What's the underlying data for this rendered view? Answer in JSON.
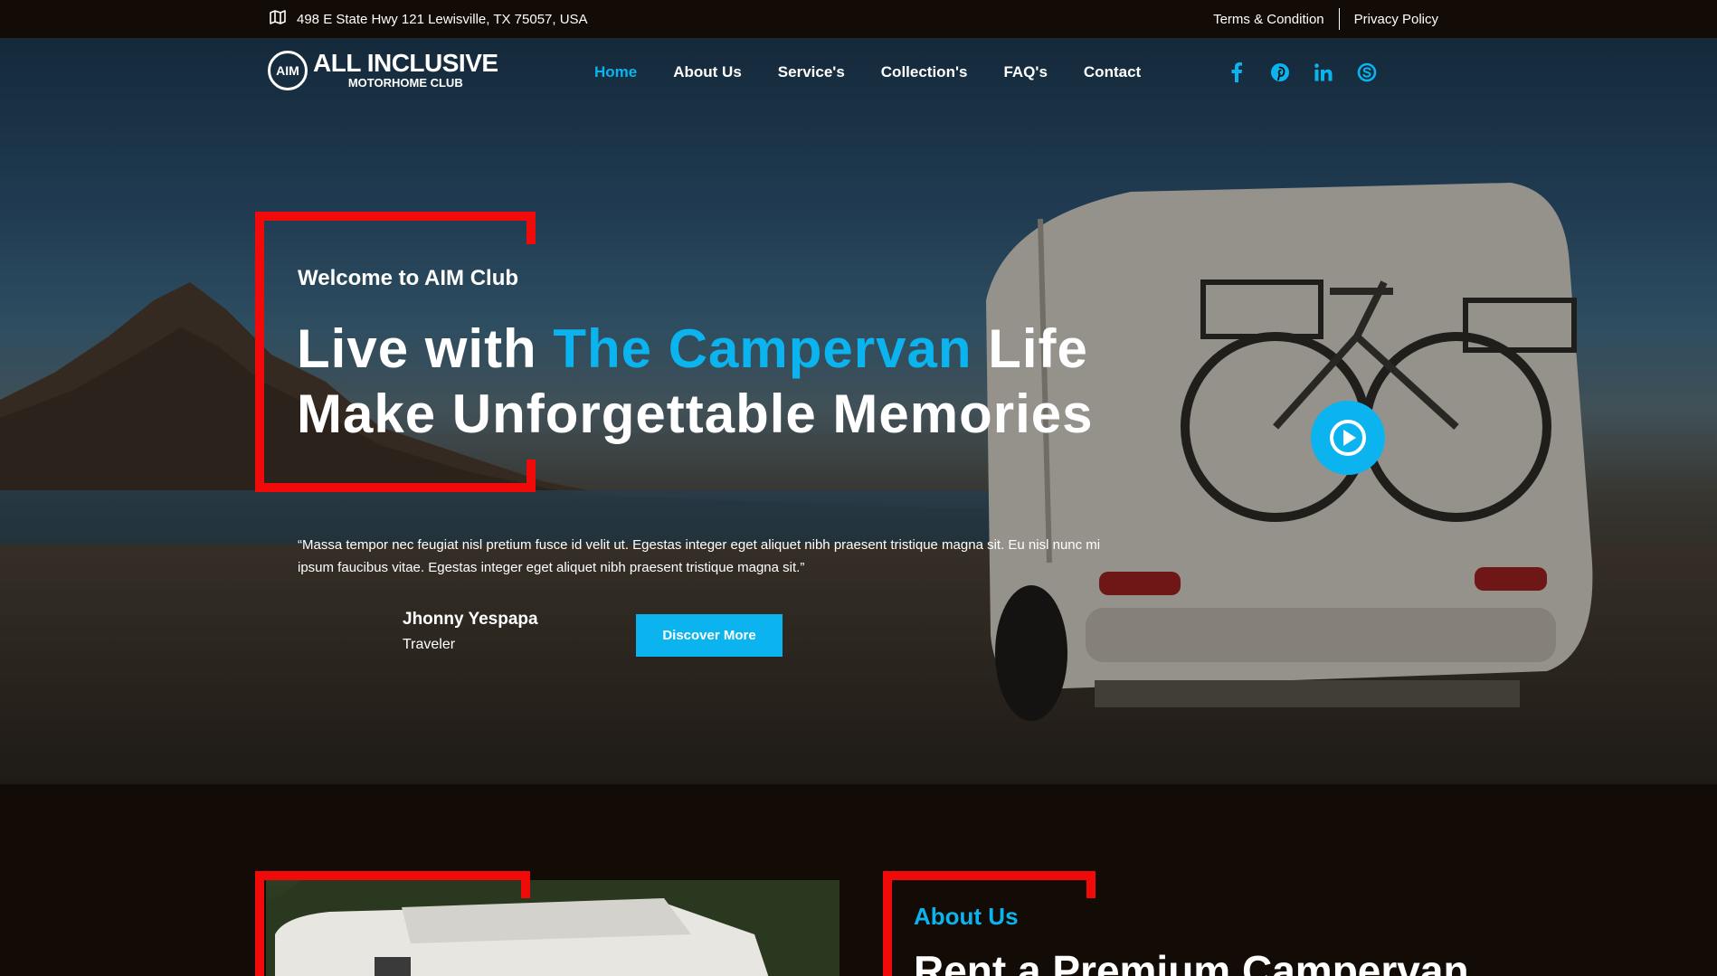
{
  "topbar": {
    "address": "498 E State Hwy 121 Lewisville, TX 75057, USA",
    "address_icon": "map-icon",
    "terms": "Terms & Condition",
    "privacy": "Privacy Policy"
  },
  "logo": {
    "badge": "AIM",
    "line1": "ALL INCLUSIVE",
    "line2": "MOTORHOME CLUB"
  },
  "nav": {
    "items": [
      {
        "label": "Home",
        "active": true
      },
      {
        "label": "About Us"
      },
      {
        "label": "Service's"
      },
      {
        "label": "Collection's"
      },
      {
        "label": "FAQ's"
      },
      {
        "label": "Contact"
      }
    ]
  },
  "social": [
    "facebook-icon",
    "pinterest-icon",
    "linkedin-icon",
    "skype-icon"
  ],
  "hero": {
    "welcome": "Welcome to AIM Club",
    "headline_part1": "Live with ",
    "headline_accent": "The Campervan",
    "headline_part2": " Life",
    "headline_line2": "Make Unforgettable Memories",
    "quote": "“Massa tempor nec feugiat nisl pretium fusce id velit ut. Egestas integer eget aliquet nibh praesent tristique magna sit. Eu nisl nunc mi ipsum faucibus vitae. Egestas integer eget aliquet nibh praesent tristique magna sit.”",
    "author_name": "Jhonny Yespapa",
    "author_role": "Traveler",
    "cta": "Discover More"
  },
  "about": {
    "label": "About Us",
    "title": "Rent a Premium Campervan"
  },
  "colors": {
    "accent": "#0bb4ee",
    "frame": "#f00a0a",
    "background": "#130b05"
  }
}
